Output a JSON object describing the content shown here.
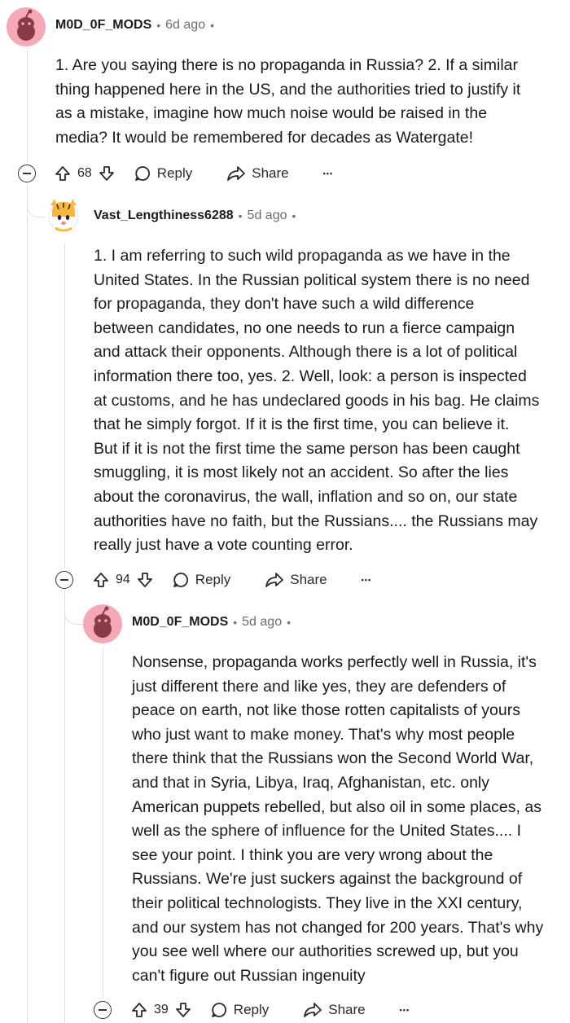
{
  "comments": [
    {
      "username": "M0D_0F_MODS",
      "separator": "•",
      "time": "6d ago",
      "time_suffix": "•",
      "lines": [
        "1. Are you saying there is no propaganda in Russia? 2. If a similar",
        "thing happened here in the US, and the authorities tried to justify it",
        "as a mistake, imagine how much noise would be raised in the",
        "media? It would be remembered for decades as Watergate!"
      ],
      "votes": "68",
      "reply_label": "Reply",
      "share_label": "Share",
      "more_label": "•••",
      "avatar_icon": "snoo-avatar-pink"
    },
    {
      "username": "Vast_Lengthiness6288",
      "separator": "•",
      "time": "5d ago",
      "time_suffix": "•",
      "lines": [
        "1. I am referring to such wild propaganda as we have in the",
        "United States. In the Russian political system there is no need",
        "for propaganda, they don't have such a wild difference",
        "between candidates, no one needs to run a fierce campaign",
        "and attack their opponents. Although there is a lot of political",
        "information there too, yes. 2. Well, look: a person is inspected",
        "at customs, and he has undeclared goods in his bag. He claims",
        "that he simply forgot. If it is the first time, you can believe it.",
        "But if it is not the first time the same person has been caught",
        "smuggling, it is most likely not an accident. So after the lies",
        "about the coronavirus, the wall, inflation and so on, our state",
        "authorities have no faith, but the Russians.... the Russians may",
        "really just have a vote counting error."
      ],
      "votes": "94",
      "reply_label": "Reply",
      "share_label": "Share",
      "more_label": "•••",
      "avatar_icon": "snoo-avatar-tiger"
    },
    {
      "username": "M0D_0F_MODS",
      "separator": "•",
      "time": "5d ago",
      "time_suffix": "•",
      "lines": [
        "Nonsense, propaganda works perfectly well in Russia, it's",
        "just different there and like yes, they are defenders of",
        "peace on earth, not like those rotten capitalists of yours",
        "who just want to make money. That's why most people",
        "there think that the Russians won the Second World War,",
        "and that in Syria, Libya, Iraq, Afghanistan, etc. only",
        "American puppets rebelled, but also oil in some places, as",
        "well as the sphere of influence for the United States.... I",
        "see your point. I think you are very wrong about the",
        "Russians. We're just suckers against the background of",
        "their political technologists. They live in the XXI century,",
        "and our system has not changed for 200 years. That's why",
        "you see well where our authorities screwed up, but you",
        "can't figure out Russian ingenuity"
      ],
      "votes": "39",
      "reply_label": "Reply",
      "share_label": "Share",
      "more_label": "•••",
      "avatar_icon": "snoo-avatar-pink"
    }
  ],
  "colors": {
    "avatar_pink": "#f7a8b8",
    "snoo_dark": "#8a3b46",
    "tiger_orange": "#f5b83d",
    "thread_line": "#dde1e4"
  }
}
